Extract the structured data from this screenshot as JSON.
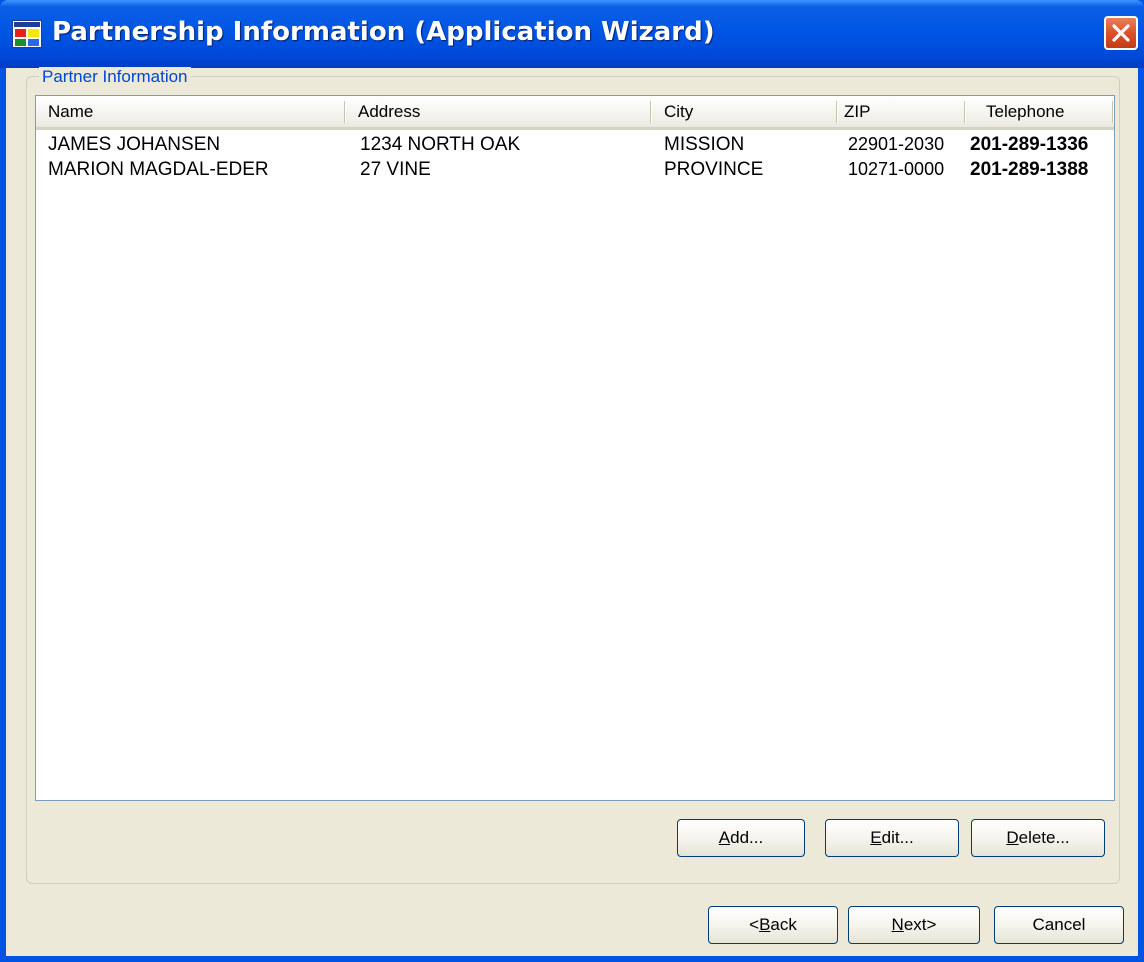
{
  "window": {
    "title": "Partnership Information (Application Wizard)"
  },
  "group": {
    "label": "Partner Information"
  },
  "table": {
    "columns": [
      "Name",
      "Address",
      "City",
      "ZIP",
      "Telephone"
    ],
    "rows": [
      [
        "JAMES JOHANSEN",
        "1234 NORTH OAK",
        "MISSION",
        "22901-2030",
        "201-289-1336"
      ],
      [
        "MARION MAGDAL-EDER",
        "27 VINE",
        "PROVINCE",
        "10271-0000",
        "201-289-1388"
      ]
    ]
  },
  "buttons": {
    "add": {
      "mnemonic": "A",
      "rest": "dd..."
    },
    "edit": {
      "mnemonic": "E",
      "rest": "dit..."
    },
    "delete": {
      "mnemonic": "D",
      "rest": "elete..."
    },
    "back": {
      "prefix": "<",
      "mnemonic": "B",
      "rest": "ack"
    },
    "next": {
      "mnemonic": "N",
      "rest": "ext>"
    },
    "cancel": {
      "label": "Cancel"
    }
  },
  "icons": {
    "app": "application-window-icon",
    "close": "close-icon"
  },
  "colors": {
    "titlebar": "#0054e3",
    "client": "#ece9d8",
    "group_label": "#0046d5",
    "close_button": "#d94e28"
  }
}
